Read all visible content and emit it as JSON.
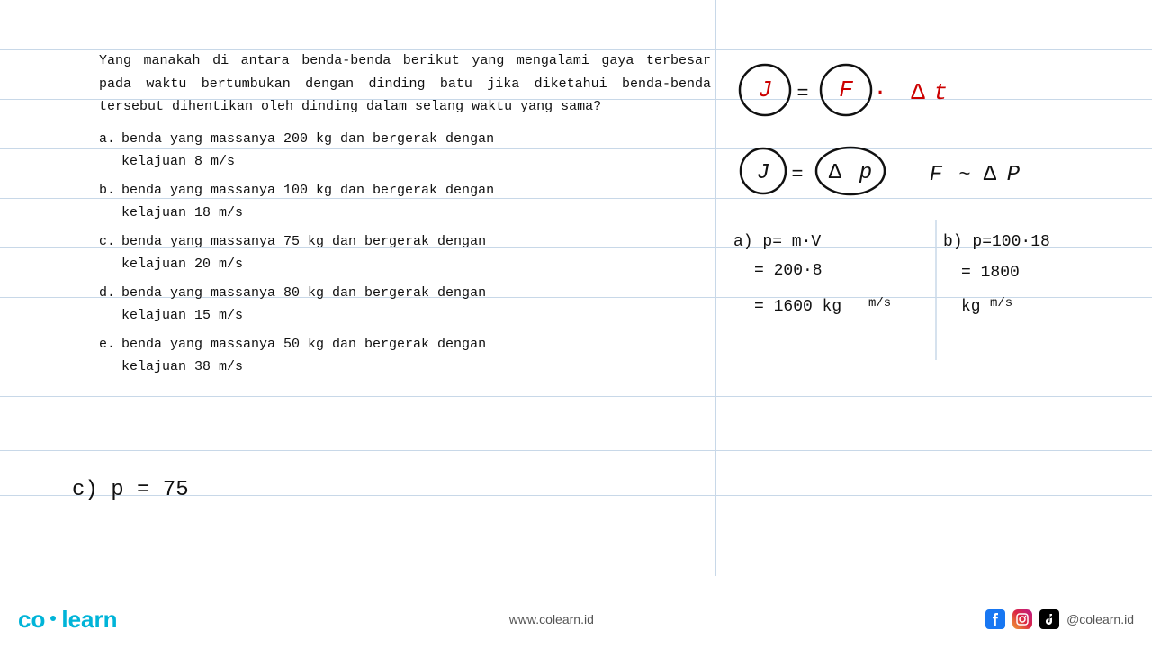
{
  "question": {
    "text": "Yang  manakah  di  antara  benda-benda  berikut  yang\nmengalami  gaya  terbesar  pada  waktu  bertumbukan\ndengan dinding batu jika diketahui benda-benda tersebut\ndihentikan oleh dinding dalam selang waktu yang sama?",
    "options": [
      {
        "label": "a.",
        "text": "benda  yang  massanya  200  kg  dan  bergerak  dengan\nkelajuan 8 m/s"
      },
      {
        "label": "b.",
        "text": "benda  yang  massanya  100  kg  dan  bergerak  dengan\nkelajuan 18 m/s"
      },
      {
        "label": "c.",
        "text": "benda  yang  massanya  75  kg  dan  bergerak  dengan\nkelajuan 20 m/s"
      },
      {
        "label": "d.",
        "text": "benda  yang  massanya  80  kg  dan  bergerak  dengan\nkelajuan 15 m/s"
      },
      {
        "label": "e.",
        "text": "benda  yang  massanya  50  kg  dan  bergerak  dengan\nkelajuan 38 m/s"
      }
    ]
  },
  "footer": {
    "logo_co": "co",
    "logo_learn": "learn",
    "website": "www.colearn.id",
    "social_handle": "@colearn.id"
  },
  "lines": [
    60,
    120,
    180,
    240,
    300,
    360,
    420,
    480,
    500
  ]
}
